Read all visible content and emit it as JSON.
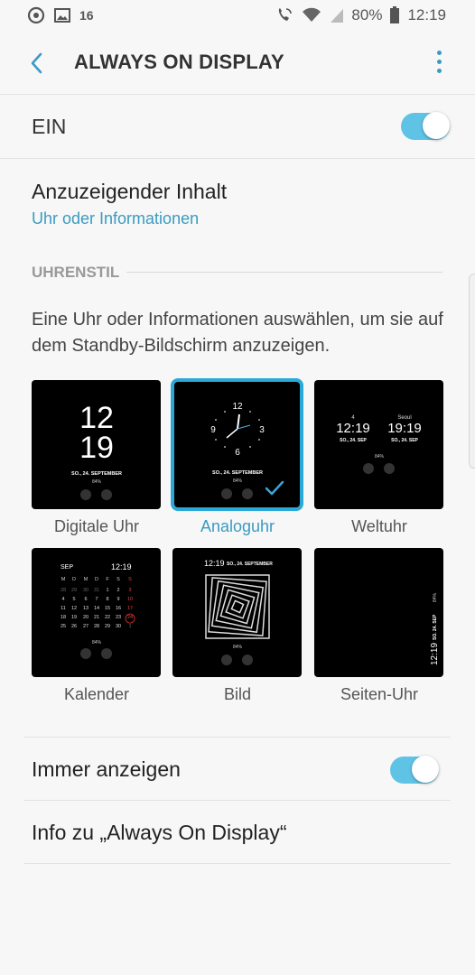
{
  "status_bar": {
    "notification_count": "16",
    "battery": "80%",
    "time": "12:19",
    "icons": [
      "sync-icon",
      "image-icon",
      "wifi-call-icon",
      "wifi-icon",
      "signal-icon",
      "battery-icon"
    ]
  },
  "header": {
    "title": "ALWAYS ON DISPLAY",
    "back_icon": "back-chevron-icon",
    "menu_icon": "more-vert-icon"
  },
  "master_switch": {
    "label": "EIN",
    "on": true
  },
  "content": {
    "title": "Anzuzeigender Inhalt",
    "value": "Uhr oder Informationen"
  },
  "clock_style": {
    "header": "UHRENSTIL",
    "description": "Eine Uhr oder Informationen auswählen, um sie auf dem Standby-Bildschirm anzuzeigen.",
    "selected": "Analoguhr",
    "options": [
      {
        "label": "Digitale Uhr"
      },
      {
        "label": "Analoguhr"
      },
      {
        "label": "Weltuhr"
      },
      {
        "label": "Kalender"
      },
      {
        "label": "Bild"
      },
      {
        "label": "Seiten-Uhr"
      }
    ],
    "preview_text": {
      "digital_hour": "12",
      "digital_minute": "19",
      "date": "SO., 24. SEPTEMBER",
      "battery": "84%",
      "analog_numbers": [
        "12",
        "3",
        "6",
        "9"
      ],
      "world_city_local": "4",
      "world_city_remote": "Seoul",
      "world_time_local": "12:19",
      "world_time_remote": "19:19",
      "world_date": "SO., 24. SEP",
      "calendar_month": "SEP",
      "calendar_time": "12:19",
      "calendar_weekdays": [
        "M",
        "D",
        "M",
        "D",
        "F",
        "S",
        "S"
      ],
      "calendar_weeks": [
        [
          "28",
          "29",
          "30",
          "31",
          "1",
          "2",
          "3"
        ],
        [
          "4",
          "5",
          "6",
          "7",
          "8",
          "9",
          "10"
        ],
        [
          "11",
          "12",
          "13",
          "14",
          "15",
          "16",
          "17"
        ],
        [
          "18",
          "19",
          "20",
          "21",
          "22",
          "23",
          "24"
        ],
        [
          "25",
          "26",
          "27",
          "28",
          "29",
          "30",
          "1"
        ]
      ],
      "image_time": "12:19",
      "image_date": "SO., 24. SEPTEMBER",
      "side_time": "12:19",
      "side_date": "SO. 24. SEP",
      "side_battery": "84%"
    }
  },
  "always_show": {
    "label": "Immer anzeigen",
    "on": true
  },
  "about": {
    "label": "Info zu „Always On Display“"
  },
  "colors": {
    "accent": "#3a9bc1",
    "toggle_track": "#5fc3e6",
    "selected_border": "#2aa8d8"
  }
}
